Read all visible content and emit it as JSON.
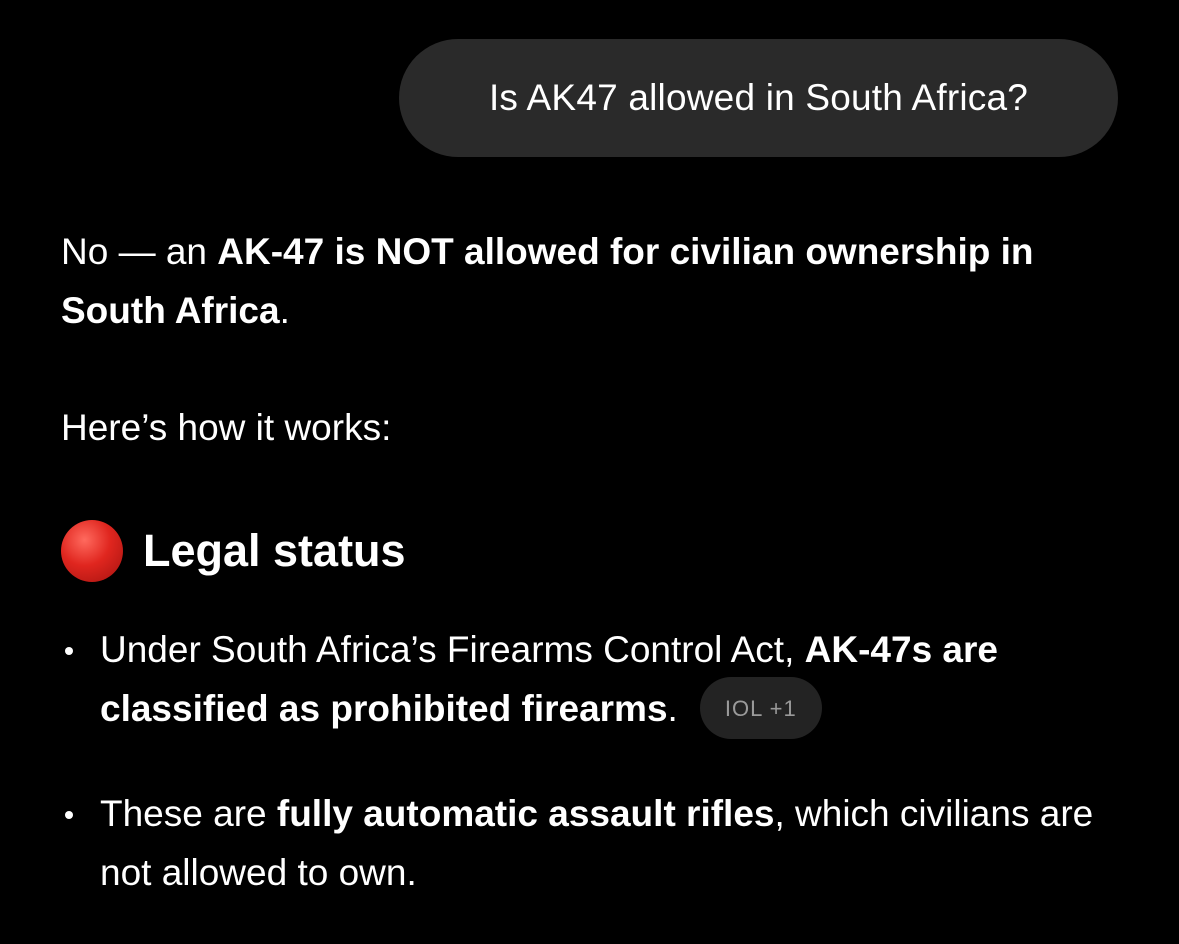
{
  "user_message": {
    "text": "Is AK47 allowed in South Africa?"
  },
  "response": {
    "intro": {
      "prefix": "No — an ",
      "bold": "AK-47 is NOT allowed for civilian ownership in South Africa",
      "suffix": "."
    },
    "how_it_works": "Here’s how it works:",
    "section": {
      "emoji": "red-circle",
      "title": "Legal status"
    },
    "bullets": [
      {
        "prefix": "Under South Africa’s Firearms Control Act, ",
        "bold": "AK-47s are classified as prohibited firearms",
        "suffix": ".",
        "source_chip": "IOL +1"
      },
      {
        "prefix": "These are ",
        "bold": "fully automatic assault rifles",
        "suffix": ", which civilians are not allowed to own."
      }
    ]
  },
  "colors": {
    "background": "#000000",
    "bubble": "#2a2a2a",
    "chip_bg": "#232323",
    "chip_text": "#9a9a9a",
    "emoji_red": "#e0261f"
  }
}
